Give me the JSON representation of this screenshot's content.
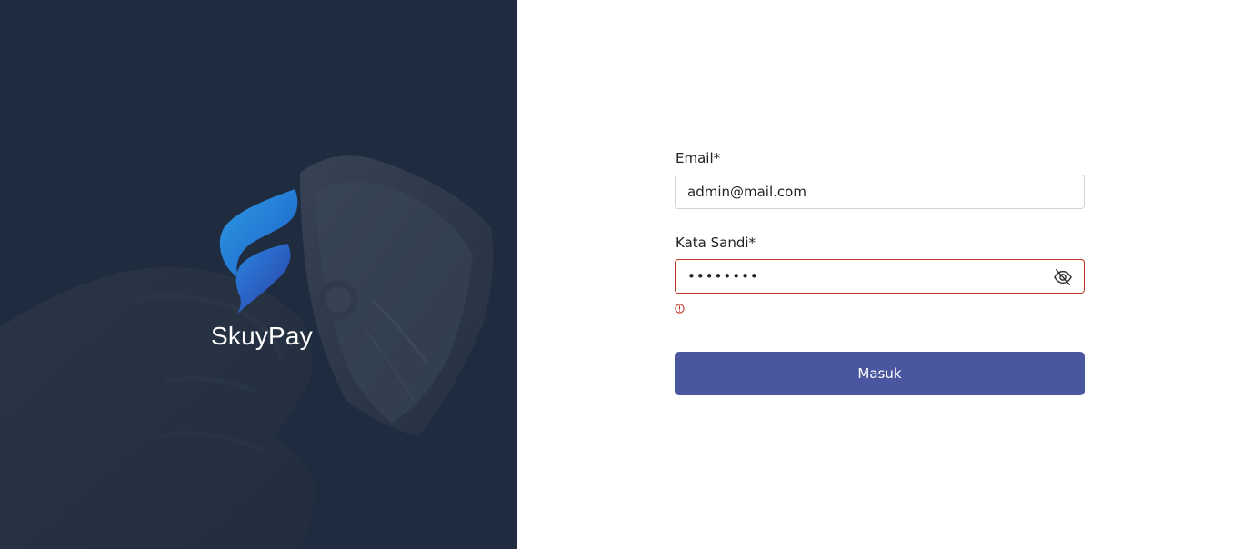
{
  "brand": {
    "name": "SkuyPay"
  },
  "form": {
    "email": {
      "label": "Email*",
      "value": "admin@mail.com"
    },
    "password": {
      "label": "Kata Sandi*",
      "value": "password",
      "toggle_icon": "eye-off-icon",
      "state": "error",
      "error_message": ""
    },
    "submit_label": "Masuk"
  },
  "colors": {
    "hero_background": "#1f2c40",
    "primary_button": "#4a56a0",
    "error": "#c0392b",
    "input_border": "#cfd2d6"
  }
}
